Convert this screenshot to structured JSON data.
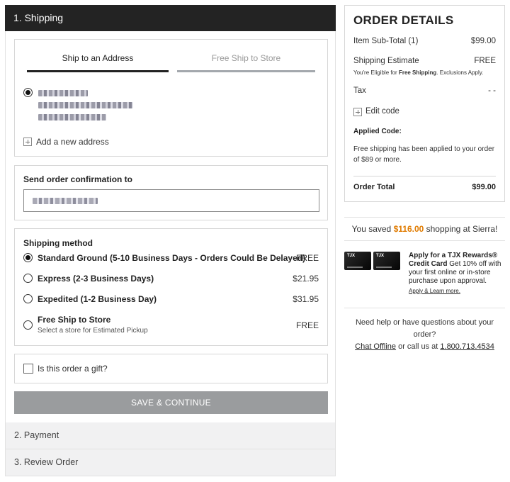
{
  "steps": {
    "shipping": "1. Shipping",
    "payment": "2. Payment",
    "review": "3. Review Order"
  },
  "address": {
    "tabs": [
      "Ship to an Address",
      "Free Ship to Store"
    ],
    "add_new": "Add a new address"
  },
  "email": {
    "title": "Send order confirmation to"
  },
  "shipping_method": {
    "title": "Shipping method",
    "options": [
      {
        "label": "Standard Ground (5-10 Business Days - Orders Could Be Delayed)",
        "price": "FREE"
      },
      {
        "label": "Express (2-3 Business Days)",
        "price": "$21.95"
      },
      {
        "label": "Expedited (1-2 Business Day)",
        "price": "$31.95"
      },
      {
        "label": "Free Ship to Store",
        "sub": "Select a store for Estimated Pickup",
        "price": "FREE"
      }
    ]
  },
  "gift": {
    "label": "Is this order a gift?"
  },
  "save_button": "SAVE & CONTINUE",
  "order_details": {
    "title": "ORDER DETAILS",
    "subtotal_label": "Item Sub-Total (1)",
    "subtotal_value": "$99.00",
    "shipping_label": "Shipping Estimate",
    "shipping_value": "FREE",
    "shipping_note_pre": "You're Eligible for ",
    "shipping_note_bold": "Free Shipping",
    "shipping_note_post": ". Exclusions Apply.",
    "tax_label": "Tax",
    "tax_value": "- -",
    "edit_code": "Edit code",
    "applied_title": "Applied Code:",
    "applied_desc": "Free shipping has been applied to your order of $89 or more.",
    "total_label": "Order Total",
    "total_value": "$99.00"
  },
  "savings": {
    "pre": "You saved ",
    "amount": "$116.00",
    "post": " shopping at Sierra!"
  },
  "tjx": {
    "card_text_1": "TJX",
    "card_text_2": "TJX",
    "title": "Apply for a TJX Rewards® Credit Card",
    "desc": " Get 10% off with your first online or in-store purchase upon approval.",
    "link": "Apply & Learn more."
  },
  "help": {
    "line1": "Need help or have questions about your order?",
    "chat": "Chat Offline",
    "middle": " or call us at ",
    "phone": "1.800.713.4534"
  }
}
